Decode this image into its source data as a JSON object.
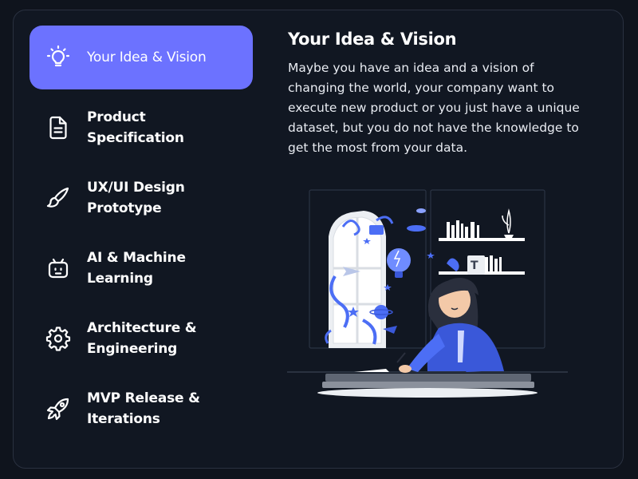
{
  "steps": [
    {
      "label": "Your Idea & Vision",
      "icon": "lightbulb-icon",
      "active": true
    },
    {
      "label": "Product Specification",
      "icon": "document-icon",
      "active": false
    },
    {
      "label": "UX/UI Design\nPrototype",
      "icon": "brush-icon",
      "active": false
    },
    {
      "label": "AI & Machine\nLearning",
      "icon": "robot-icon",
      "active": false
    },
    {
      "label": "Architecture &\nEngineering",
      "icon": "gear-icon",
      "active": false
    },
    {
      "label": "MVP Release &\nIterations",
      "icon": "rocket-icon",
      "active": false
    }
  ],
  "content": {
    "title": "Your Idea & Vision",
    "description": "Maybe you have an idea and a vision of changing the world, your company want to execute new product or you just have a unique dataset, but you do not have the knowledge to get the most from your data."
  },
  "colors": {
    "background": "#0f141d",
    "panel": "#111722",
    "accent": "#6c72ff",
    "illustration_blue": "#4c6ef5"
  }
}
